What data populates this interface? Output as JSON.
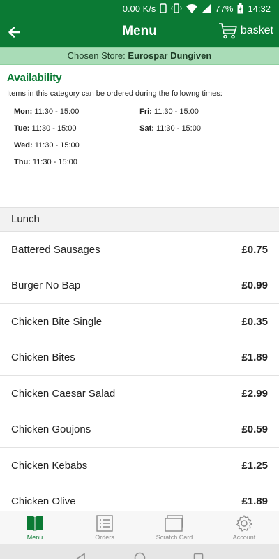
{
  "status_bar": {
    "net_speed": "0.00 K/s",
    "battery": "77%",
    "time": "14:32"
  },
  "app_bar": {
    "title": "Menu",
    "basket_label": "basket"
  },
  "store": {
    "prefix": "Chosen Store:",
    "name": "Eurospar Dungiven"
  },
  "availability": {
    "heading": "Availability",
    "description": "Items in this category can be ordered during the followng times:",
    "left": [
      {
        "day": "Mon:",
        "hours": "11:30 - 15:00"
      },
      {
        "day": "Tue:",
        "hours": "11:30 - 15:00"
      },
      {
        "day": "Wed:",
        "hours": "11:30 - 15:00"
      },
      {
        "day": "Thu:",
        "hours": "11:30 - 15:00"
      }
    ],
    "right": [
      {
        "day": "Fri:",
        "hours": "11:30 - 15:00"
      },
      {
        "day": "Sat:",
        "hours": "11:30 - 15:00"
      }
    ]
  },
  "category": "Lunch",
  "items": [
    {
      "name": "Battered Sausages",
      "price": "£0.75"
    },
    {
      "name": "Burger No Bap",
      "price": "£0.99"
    },
    {
      "name": "Chicken Bite Single",
      "price": "£0.35"
    },
    {
      "name": "Chicken Bites",
      "price": "£1.89"
    },
    {
      "name": "Chicken Caesar Salad",
      "price": "£2.99"
    },
    {
      "name": "Chicken Goujons",
      "price": "£0.59"
    },
    {
      "name": "Chicken Kebabs",
      "price": "£1.25"
    },
    {
      "name": "Chicken Olive",
      "price": "£1.89"
    }
  ],
  "bottom_nav": [
    {
      "label": "Menu",
      "icon": "book-icon",
      "active": true
    },
    {
      "label": "Orders",
      "icon": "list-icon",
      "active": false
    },
    {
      "label": "Scratch Card",
      "icon": "card-icon",
      "active": false
    },
    {
      "label": "Account",
      "icon": "gear-icon",
      "active": false
    }
  ],
  "colors": {
    "primary": "#0b7a34",
    "store_banner": "#a9dcb7"
  }
}
